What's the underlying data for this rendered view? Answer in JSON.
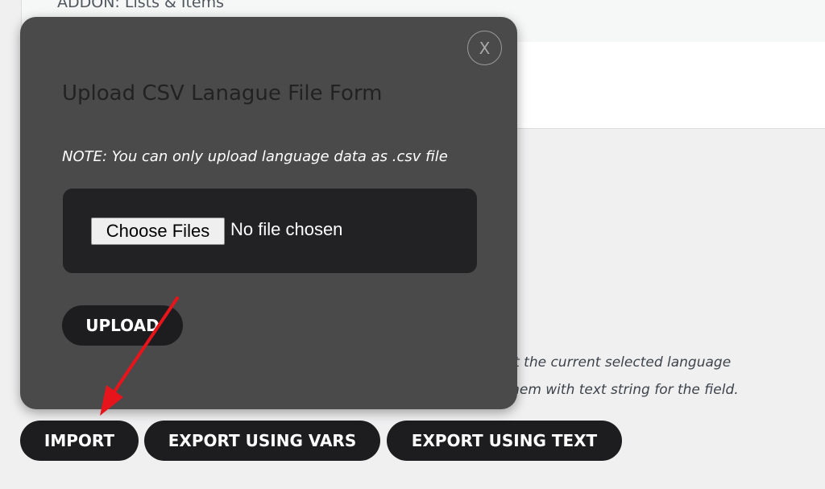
{
  "background": {
    "section_label": "ADDON: Lists & Items",
    "description_line1": "rt/export the current selected language",
    "description_line2": "ociate them with text string for the field."
  },
  "actions": {
    "import_label": "IMPORT",
    "export_vars_label": "EXPORT USING VARS",
    "export_text_label": "EXPORT USING TEXT"
  },
  "modal": {
    "close_label": "X",
    "title": "Upload CSV Lanague File Form",
    "note": "NOTE: You can only upload language data as .csv file",
    "choose_files_label": "Choose Files",
    "file_status": "No file chosen",
    "upload_label": "UPLOAD"
  },
  "colors": {
    "modal_bg": "#4a4a4a",
    "button_bg": "#1d1d1f",
    "annotation_arrow": "#e8141c"
  },
  "annotation": {
    "icon": "red-arrow-icon"
  }
}
